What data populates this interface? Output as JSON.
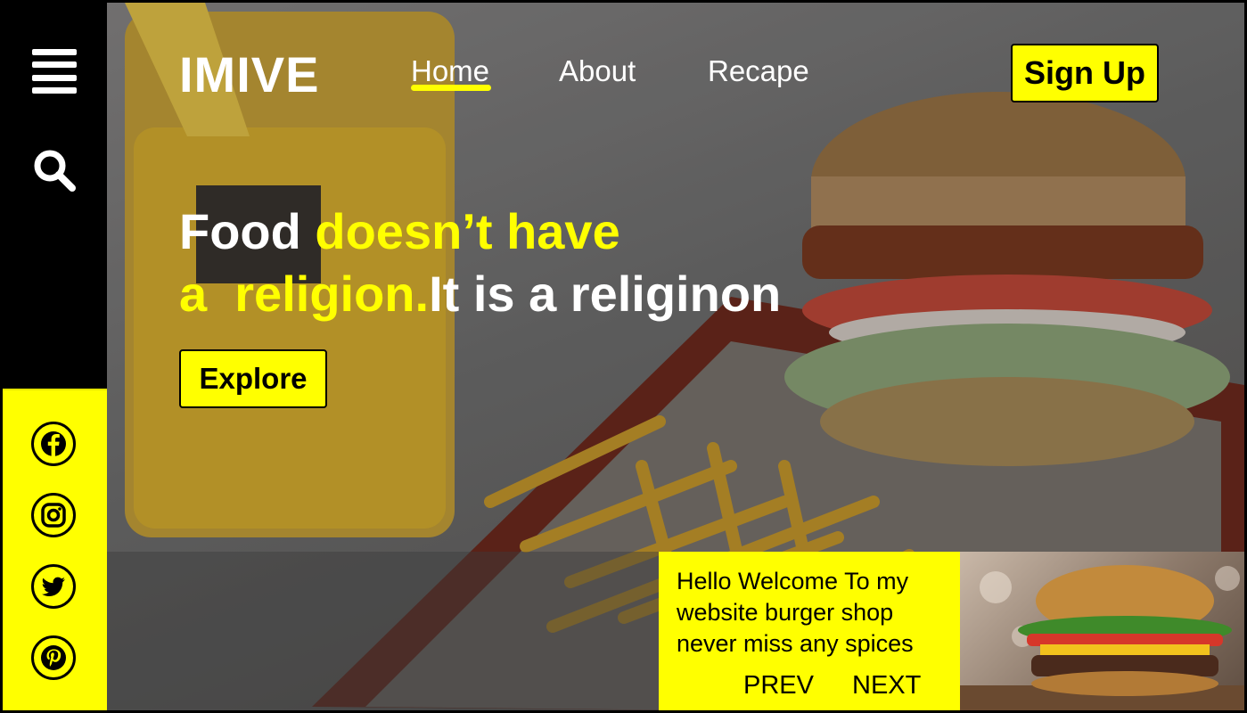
{
  "brand": {
    "logo": "IMIVE"
  },
  "nav": {
    "items": [
      {
        "label": "Home",
        "active": true
      },
      {
        "label": "About",
        "active": false
      },
      {
        "label": "Recape",
        "active": false
      }
    ],
    "signup_label": "Sign Up"
  },
  "sidebar": {
    "menu_icon": "hamburger-menu-icon",
    "search_icon": "search-icon",
    "social": [
      "facebook-icon",
      "instagram-icon",
      "twitter-icon",
      "pinterest-icon"
    ]
  },
  "hero": {
    "line1_white": "Food ",
    "line1_yellow": "doesn’t have",
    "line2_yellow": "a  religion.",
    "line2_white": "It is a religinon",
    "explore_label": "Explore"
  },
  "welcome": {
    "text": "Hello Welcome To my website burger shop never miss any spices",
    "prev_label": "PREV",
    "next_label": "NEXT"
  },
  "colors": {
    "accent": "#ffff00",
    "sidebar": "#000000",
    "text": "#ffffff"
  }
}
